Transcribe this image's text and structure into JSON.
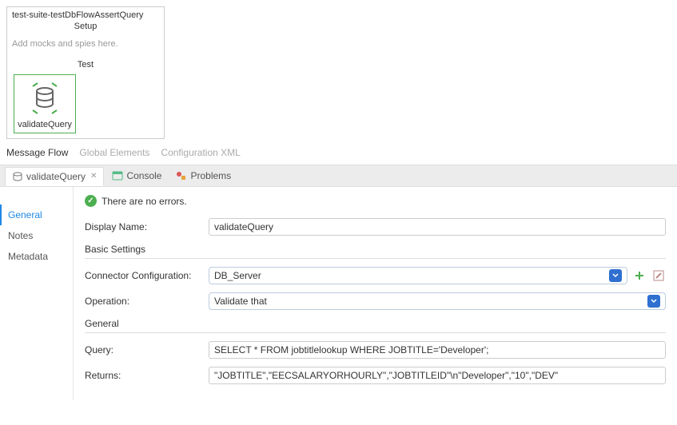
{
  "flow": {
    "title": "test-suite-testDbFlowAssertQuery",
    "setup_label": "Setup",
    "mocks_placeholder": "Add mocks and spies here.",
    "test_label": "Test",
    "component_label": "validateQuery"
  },
  "canvas_tabs": {
    "message_flow": "Message Flow",
    "global_elements": "Global Elements",
    "config_xml": "Configuration XML"
  },
  "panel_tabs": {
    "validate": "validateQuery",
    "console": "Console",
    "problems": "Problems"
  },
  "status": {
    "message": "There are no errors."
  },
  "sidebar": {
    "general": "General",
    "notes": "Notes",
    "metadata": "Metadata"
  },
  "form": {
    "display_name_label": "Display Name:",
    "display_name_value": "validateQuery",
    "basic_settings_label": "Basic Settings",
    "connector_config_label": "Connector Configuration:",
    "connector_config_value": "DB_Server",
    "operation_label": "Operation:",
    "operation_value": "Validate that",
    "general_label": "General",
    "query_label": "Query:",
    "query_value": "SELECT * FROM jobtitlelookup WHERE JOBTITLE='Developer';",
    "returns_label": "Returns:",
    "returns_value": "\"JOBTITLE\",\"EECSALARYORHOURLY\",\"JOBTITLEID\"\\n\"Developer\",\"10\",\"DEV\""
  }
}
